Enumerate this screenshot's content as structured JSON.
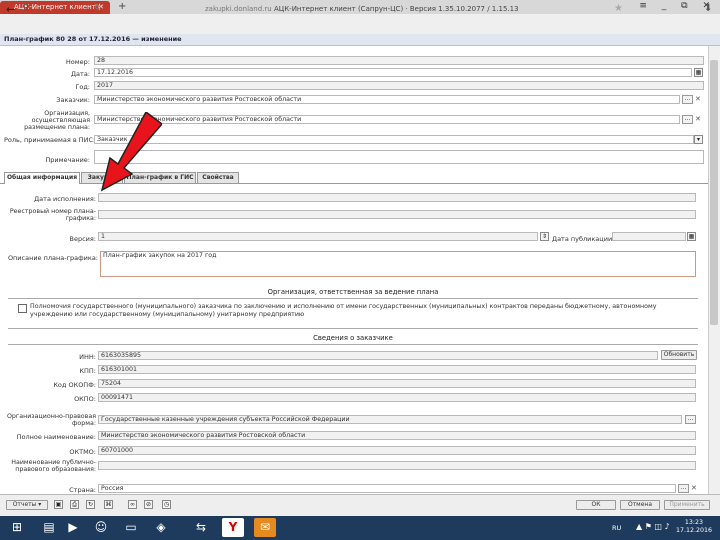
{
  "browser": {
    "tab_title": "АЦК-Интернет клиент (",
    "new_tab": "+",
    "window_controls": "≡ _ ⧉ ✕",
    "back": "←",
    "logo": "Я",
    "url_domain": "zakupki.donland.ru",
    "url_title": "АЦК-Интернет клиент (Сапрун-ЦС) · Версия 1.35.10.2077 / 1.15.13",
    "star": "★",
    "download": "⬇"
  },
  "window": {
    "title": "План-график 80 28 от 17.12.2016 — изменение"
  },
  "header_fields": {
    "number_label": "Номер:",
    "number_value": "28",
    "date_label": "Дата:",
    "date_value": "17.12.2016",
    "year_label": "Год:",
    "year_value": "2017",
    "customer_label": "Заказчик:",
    "customer_value": "Министерство экономического развития Ростовской области",
    "org_label": "Организация, осуществляющая размещение плана:",
    "org_value": "Министерство экономического развития Ростовской области",
    "place_label": "Роль, принимаемая в ПИС:",
    "place_value": "Заказчик",
    "comment_label": "Примечание:",
    "comment_value": ""
  },
  "tabs": [
    {
      "label": "Общая информация"
    },
    {
      "label": "Закупки"
    },
    {
      "label": "План-график в ГИС"
    },
    {
      "label": "Свойства"
    }
  ],
  "general": {
    "plan_number_label": "Дата исполнения:",
    "reg_number_label": "Реестровый номер плана-графика:",
    "version_label": "Версия:",
    "version_value": "1",
    "publish_label": "Дата публикации:",
    "publish_value": "",
    "desc_label": "Описание плана-графика:",
    "desc_value": "План-график закупок на 2017 год",
    "resp_section": "Организация, ответственная за ведение плана",
    "checkbox_text": "Полномочия государственного (муниципального) заказчика по заключению и исполнению от имени государственных (муниципальных) контрактов переданы бюджетному, автономному учреждению или государственному (муниципальному) унитарному предприятию",
    "customer_section": "Сведения о заказчике",
    "inn_label": "ИНН:",
    "inn_value": "6163035895",
    "kpp_label": "КПП:",
    "kpp_value": "616301001",
    "okopf_label": "Код ОКОПФ:",
    "okopf_value": "75204",
    "okpo_label": "ОКПО:",
    "okpo_value": "00091471",
    "update_button": "Обновить",
    "legal_form_label": "Организационно-правовая форма:",
    "legal_form_value": "Государственные казенные учреждения субъекта Российской Федерации",
    "full_name_label": "Полное наименование:",
    "full_name_value": "Министерство экономического развития Ростовской области",
    "okato_label": "ОКТМО:",
    "okato_value": "60701000",
    "public_name_label": "Наименование публично-правового образования:",
    "public_name_value": "",
    "country_label": "Страна:",
    "country_value": "Россия"
  },
  "bottom": {
    "report_button": "Отчеты",
    "ok_button": "ОК",
    "cancel_button": "Отмена",
    "apply_button": "Применить"
  },
  "taskbar": {
    "time": "13:23",
    "date": "17.12.2016",
    "lang": "RU"
  },
  "colors": {
    "tab_red": "#c0392b",
    "arrow_red": "#e8141b",
    "taskbar": "#1e3a5c"
  }
}
